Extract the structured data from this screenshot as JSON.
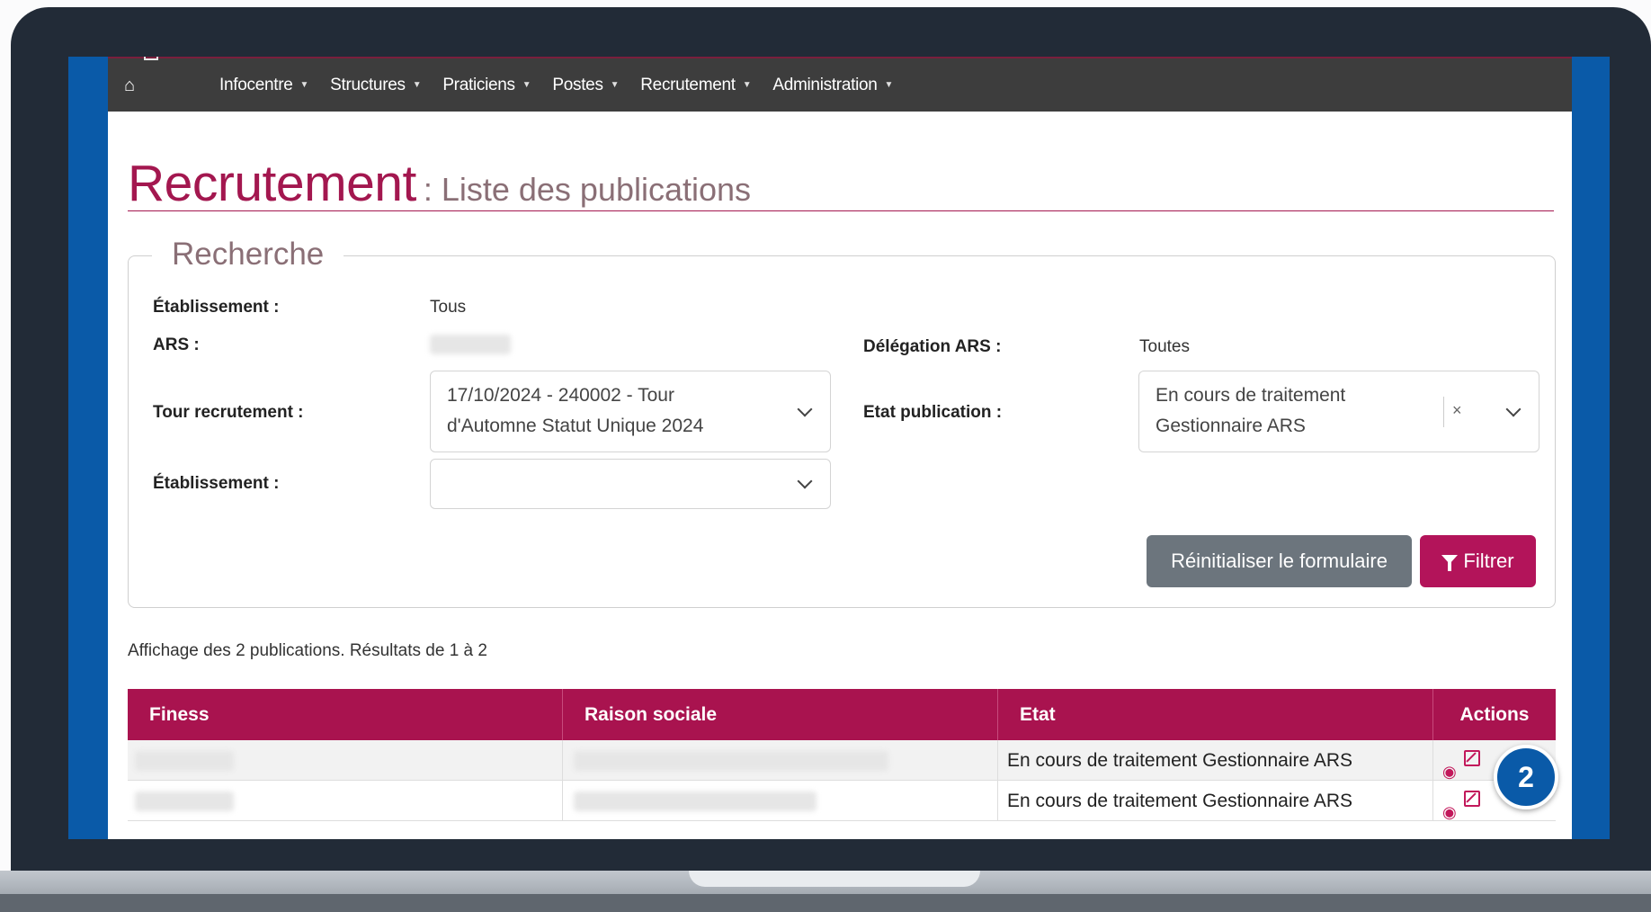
{
  "nav": {
    "items": [
      {
        "label": "Infocentre"
      },
      {
        "label": "Structures"
      },
      {
        "label": "Praticiens"
      },
      {
        "label": "Postes"
      },
      {
        "label": "Recrutement"
      },
      {
        "label": "Administration"
      }
    ]
  },
  "page": {
    "title": "Recrutement",
    "subtitle": ": Liste des publications"
  },
  "search": {
    "legend": "Recherche",
    "etablissement_label": "Établissement :",
    "etablissement_value": "Tous",
    "ars_label": "ARS :",
    "delegation_label": "Délégation ARS :",
    "delegation_value": "Toutes",
    "tour_label": "Tour recrutement :",
    "tour_value_line1": "17/10/2024 - 240002 - Tour",
    "tour_value_line2": "d'Automne Statut Unique 2024",
    "etat_label": "Etat publication :",
    "etat_value_line1": "En cours de traitement",
    "etat_value_line2": "Gestionnaire ARS",
    "etat_clear": "×",
    "etablissement2_label": "Établissement :",
    "reset_button": "Réinitialiser le formulaire",
    "filter_button": "Filtrer"
  },
  "results": {
    "info": "Affichage des 2 publications. Résultats de 1 à 2"
  },
  "table": {
    "headers": [
      "Finess",
      "Raison sociale",
      "Etat",
      "Actions"
    ],
    "rows": [
      {
        "etat": "En cours de traitement Gestionnaire ARS"
      },
      {
        "etat": "En cours de traitement Gestionnaire ARS"
      }
    ]
  },
  "badge": {
    "step": "2",
    "color": "#0a5aa8"
  },
  "colors": {
    "brand": "#a9134f",
    "navbar": "#3d3d3d",
    "reset_button": "#6c757d"
  },
  "icons": {
    "home": "home-icon",
    "view": "eye-icon",
    "edit": "edit-icon",
    "filter": "funnel-icon"
  }
}
